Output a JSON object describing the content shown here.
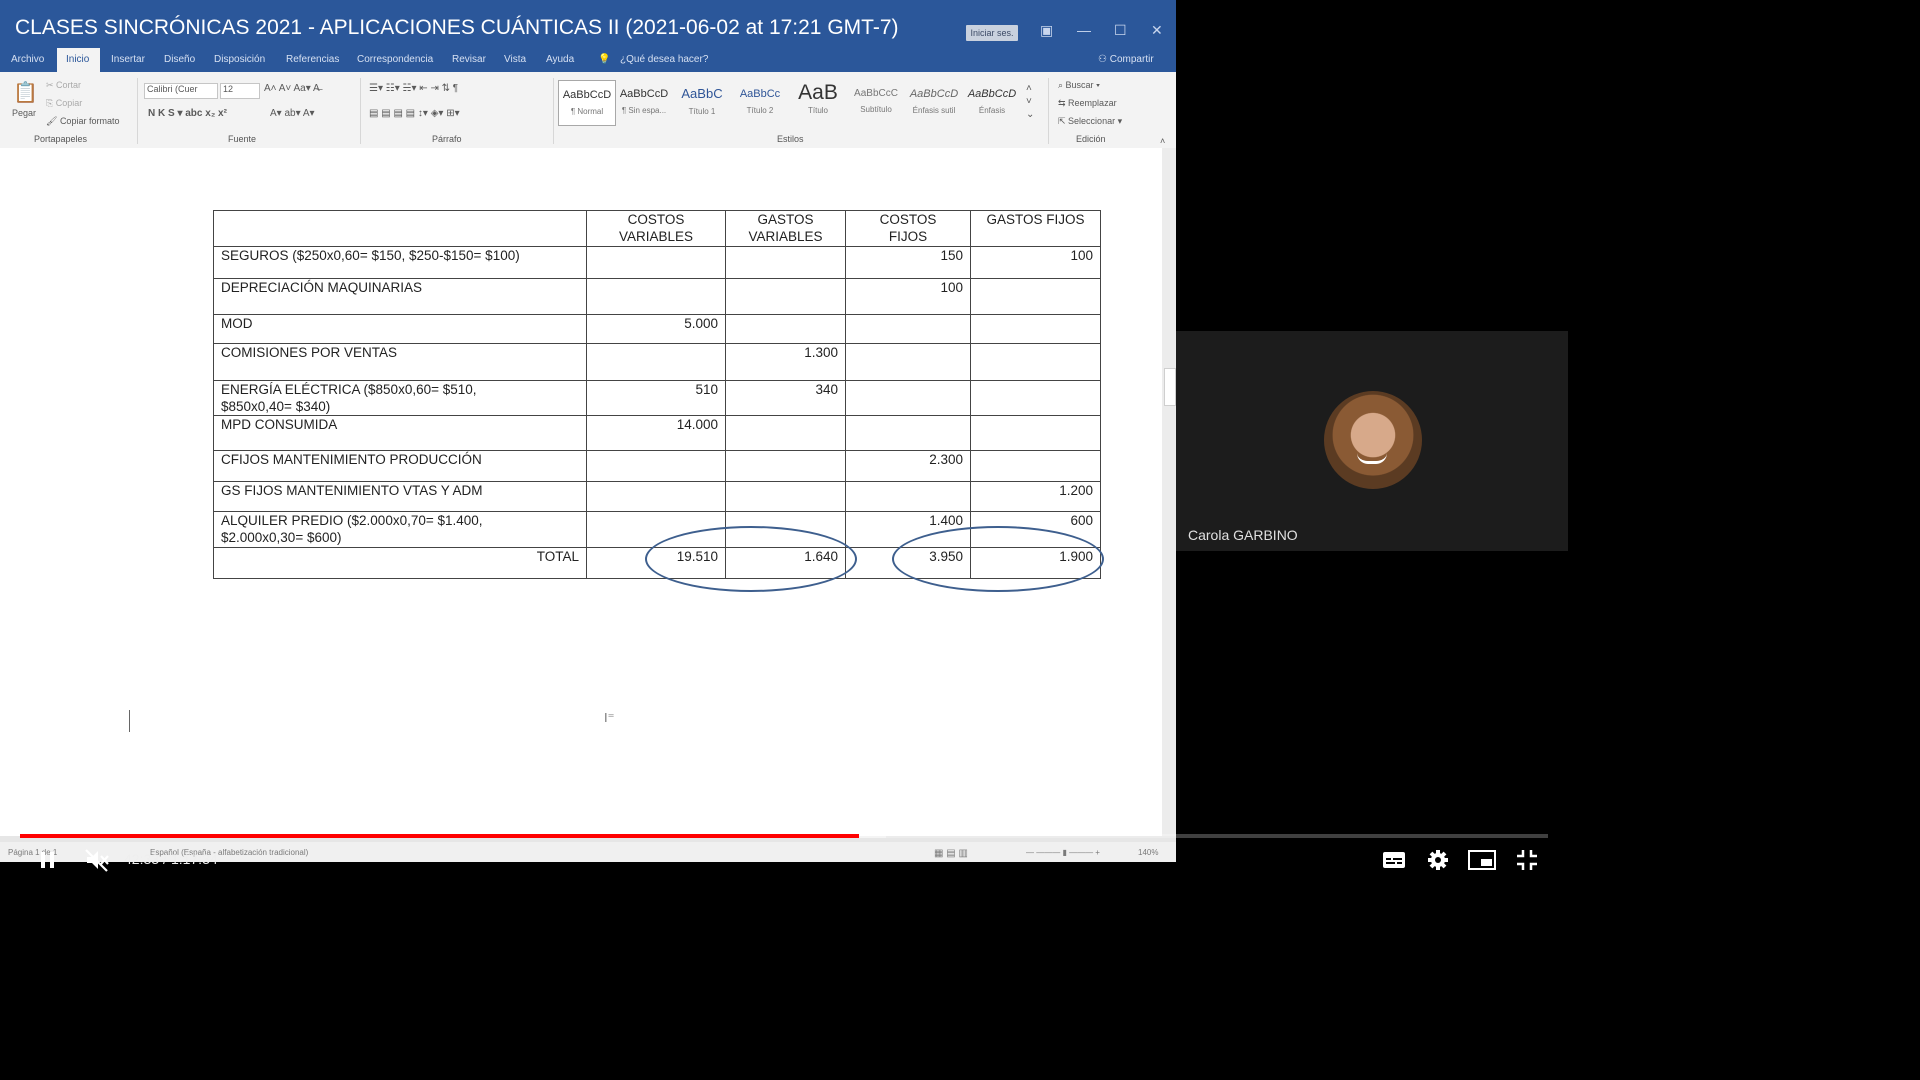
{
  "video": {
    "title": "CLASES SINCRÓNICAS 2021 - APLICACIONES CUÁNTICAS II (2021-06-02 at 17:21 GMT-7)",
    "current_time": "42:33",
    "duration": "1:17:34",
    "progress_fraction": 0.549,
    "buffered_fraction": 0.567
  },
  "word": {
    "sign_in_label": "Iniciar ses.",
    "menu": [
      "Archivo",
      "Inicio",
      "Insertar",
      "Diseño",
      "Disposición",
      "Referencias",
      "Correspondencia",
      "Revisar",
      "Vista",
      "Ayuda",
      "¿Qué desea hacer?"
    ],
    "share_label": "Compartir",
    "clipboard": {
      "paste": "Pegar",
      "cut": "Cortar",
      "copy": "Copiar",
      "format_painter": "Copiar formato",
      "label": "Portapapeles"
    },
    "font": {
      "name": "Calibri (Cuer",
      "size": "12",
      "label": "Fuente"
    },
    "paragraph_label": "Párrafo",
    "styles": [
      {
        "sample": "AaBbCcD",
        "name": "¶ Normal"
      },
      {
        "sample": "AaBbCcD",
        "name": "¶ Sin espa..."
      },
      {
        "sample": "AaBbC",
        "name": "Título 1"
      },
      {
        "sample": "AaBbCc",
        "name": "Título 2"
      },
      {
        "sample": "AaB",
        "name": "Título"
      },
      {
        "sample": "AaBbCcC",
        "name": "Subtítulo"
      },
      {
        "sample": "AaBbCcD",
        "name": "Énfasis sutil"
      },
      {
        "sample": "AaBbCcD",
        "name": "Énfasis"
      }
    ],
    "styles_label": "Estilos",
    "editing": {
      "find": "Buscar",
      "replace": "Reemplazar",
      "select": "Seleccionar",
      "label": "Edición"
    },
    "status": {
      "page": "Página 1 de 1",
      "language": "Español (España - alfabetización tradicional)",
      "zoom": "140%"
    }
  },
  "table": {
    "headers": [
      "",
      "COSTOS\nVARIABLES",
      "GASTOS\nVARIABLES",
      "COSTOS\nFIJOS",
      "GASTOS FIJOS"
    ],
    "rows": [
      [
        "SEGUROS ($250x0,60= $150, $250-$150= $100)",
        "",
        "",
        "150",
        "100"
      ],
      [
        "DEPRECIACIÓN MAQUINARIAS",
        "",
        "",
        "100",
        ""
      ],
      [
        "MOD",
        "5.000",
        "",
        "",
        ""
      ],
      [
        "COMISIONES POR VENTAS",
        "",
        "1.300",
        "",
        ""
      ],
      [
        "ENERGÍA ELÉCTRICA ($850x0,60= $510,\n$850x0,40= $340)",
        "510",
        "340",
        "",
        ""
      ],
      [
        "MPD CONSUMIDA",
        "14.000",
        "",
        "",
        ""
      ],
      [
        "CFIJOS MANTENIMIENTO PRODUCCIÓN",
        "",
        "",
        "2.300",
        ""
      ],
      [
        "GS FIJOS MANTENIMIENTO VTAS Y ADM",
        "",
        "",
        "",
        "1.200"
      ],
      [
        "ALQUILER PREDIO ($2.000x0,70= $1.400,\n$2.000x0,30= $600)",
        "",
        "",
        "1.400",
        "600"
      ]
    ],
    "total": [
      "TOTAL",
      "19.510",
      "1.640",
      "3.950",
      "1.900"
    ]
  },
  "participant": {
    "name": "Carola GARBINO"
  }
}
